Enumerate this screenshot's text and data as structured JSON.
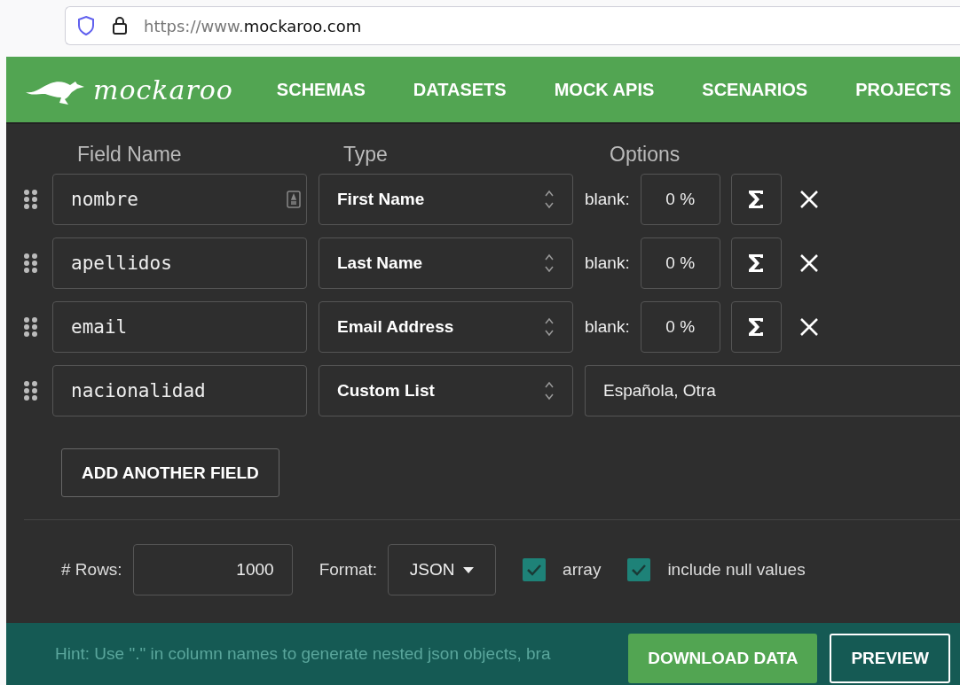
{
  "browser": {
    "url_prefix": "https://www.",
    "url_domain": "mockaroo.com"
  },
  "brand": {
    "name": "mockaroo"
  },
  "nav": [
    {
      "label": "SCHEMAS"
    },
    {
      "label": "DATASETS"
    },
    {
      "label": "MOCK APIS"
    },
    {
      "label": "SCENARIOS"
    },
    {
      "label": "PROJECTS"
    }
  ],
  "columns": [
    "Field Name",
    "Type",
    "Options"
  ],
  "fields": [
    {
      "name": "nombre",
      "type": "First Name",
      "kind": "blank",
      "blank_label": "blank:",
      "blank_value": "0 %",
      "has_card_icon": true
    },
    {
      "name": "apellidos",
      "type": "Last Name",
      "kind": "blank",
      "blank_label": "blank:",
      "blank_value": "0 %",
      "has_card_icon": false
    },
    {
      "name": "email",
      "type": "Email Address",
      "kind": "blank",
      "blank_label": "blank:",
      "blank_value": "0 %",
      "has_card_icon": false
    },
    {
      "name": "nacionalidad",
      "type": "Custom List",
      "kind": "list",
      "list_value": "Española, Otra",
      "has_card_icon": false
    }
  ],
  "add_button": "ADD ANOTHER FIELD",
  "options": {
    "rows_label": "# Rows:",
    "rows_value": "1000",
    "format_label": "Format:",
    "format_value": "JSON",
    "checkboxes": [
      {
        "label": "array",
        "checked": true
      },
      {
        "label": "include null values",
        "checked": true
      }
    ]
  },
  "footer": {
    "hint": "Hint: Use \".\" in column names to generate nested json objects, bra",
    "buttons": [
      {
        "label": "DOWNLOAD DATA",
        "kind": "primary"
      },
      {
        "label": "PREVIEW",
        "kind": "outline"
      }
    ]
  }
}
